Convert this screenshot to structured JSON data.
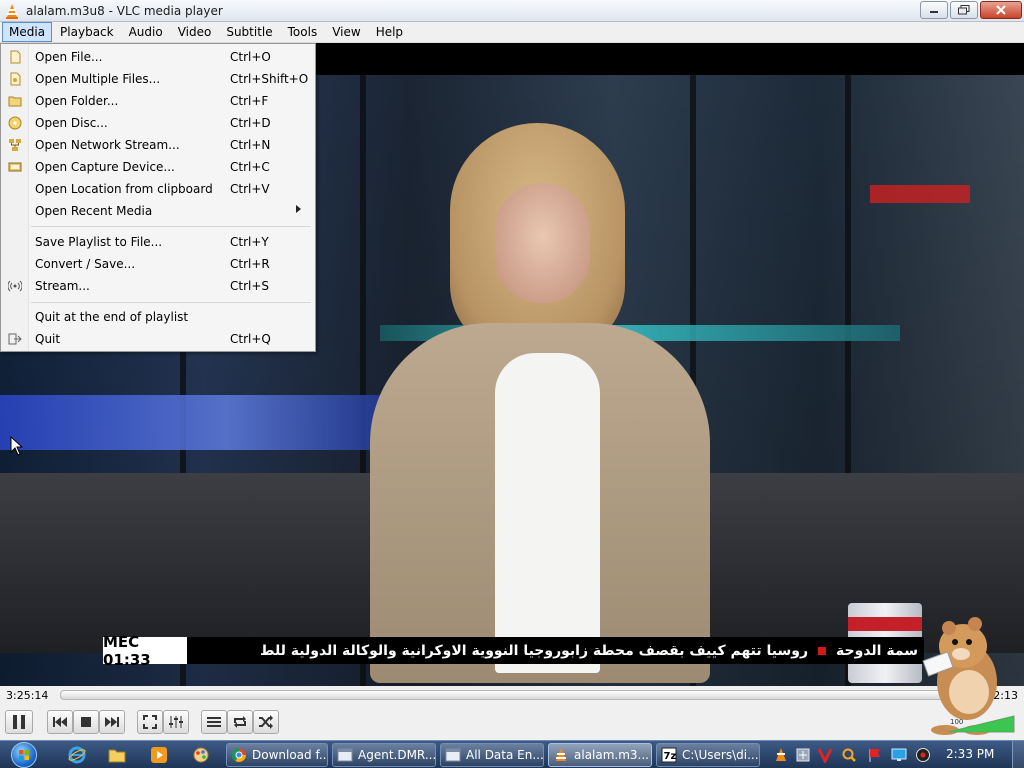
{
  "window": {
    "title": "alalam.m3u8 - VLC media player",
    "controls": [
      "minimize",
      "maximize",
      "close"
    ]
  },
  "menubar": {
    "items": [
      "Media",
      "Playback",
      "Audio",
      "Video",
      "Subtitle",
      "Tools",
      "View",
      "Help"
    ],
    "active": "Media"
  },
  "media_menu": {
    "items": [
      {
        "label": "Open File...",
        "shortcut": "Ctrl+O",
        "icon": "file-icon"
      },
      {
        "label": "Open Multiple Files...",
        "shortcut": "Ctrl+Shift+O",
        "icon": "files-icon"
      },
      {
        "label": "Open Folder...",
        "shortcut": "Ctrl+F",
        "icon": "folder-icon"
      },
      {
        "label": "Open Disc...",
        "shortcut": "Ctrl+D",
        "icon": "disc-icon"
      },
      {
        "label": "Open Network Stream...",
        "shortcut": "Ctrl+N",
        "icon": "network-icon"
      },
      {
        "label": "Open Capture Device...",
        "shortcut": "Ctrl+C",
        "icon": "capture-icon"
      },
      {
        "label": "Open Location from clipboard",
        "shortcut": "Ctrl+V",
        "icon": ""
      },
      {
        "label": "Open Recent Media",
        "shortcut": "",
        "icon": "",
        "submenu": true
      },
      {
        "label": "Save Playlist to File...",
        "shortcut": "Ctrl+Y",
        "icon": ""
      },
      {
        "label": "Convert / Save...",
        "shortcut": "Ctrl+R",
        "icon": ""
      },
      {
        "label": "Stream...",
        "shortcut": "Ctrl+S",
        "icon": "stream-icon"
      },
      {
        "label": "Quit at the end of playlist",
        "shortcut": "",
        "icon": ""
      },
      {
        "label": "Quit",
        "shortcut": "Ctrl+Q",
        "icon": "quit-icon"
      }
    ]
  },
  "video": {
    "ticker_clock": "MEC 01:33",
    "ticker_text_1": "روسيا تتهم كييف بقصف محطة زابوروجيا النووية الاوكرانية والوكالة الدولية للط",
    "ticker_text_2": "سمة الدوحة"
  },
  "playback": {
    "elapsed": "3:25:14",
    "total": "2:13",
    "progress": 0.0
  },
  "controls": {
    "buttons": [
      "pause",
      "previous",
      "stop",
      "next",
      "fullscreen",
      "extended-settings",
      "playlist",
      "loop",
      "shuffle"
    ],
    "volume_percent": 100,
    "volume_label": "100"
  },
  "taskbar": {
    "tasks": [
      {
        "label": "Download f...",
        "icon": "chrome-icon"
      },
      {
        "label": "Agent.DMR...",
        "icon": "app-window-icon"
      },
      {
        "label": "All Data En...",
        "icon": "app-window-icon"
      },
      {
        "label": "alalam.m3...",
        "icon": "vlc-icon",
        "active": true
      },
      {
        "label": "C:\\Users\\di...",
        "icon": "7zip-icon"
      }
    ],
    "clock": "2:33 PM"
  }
}
